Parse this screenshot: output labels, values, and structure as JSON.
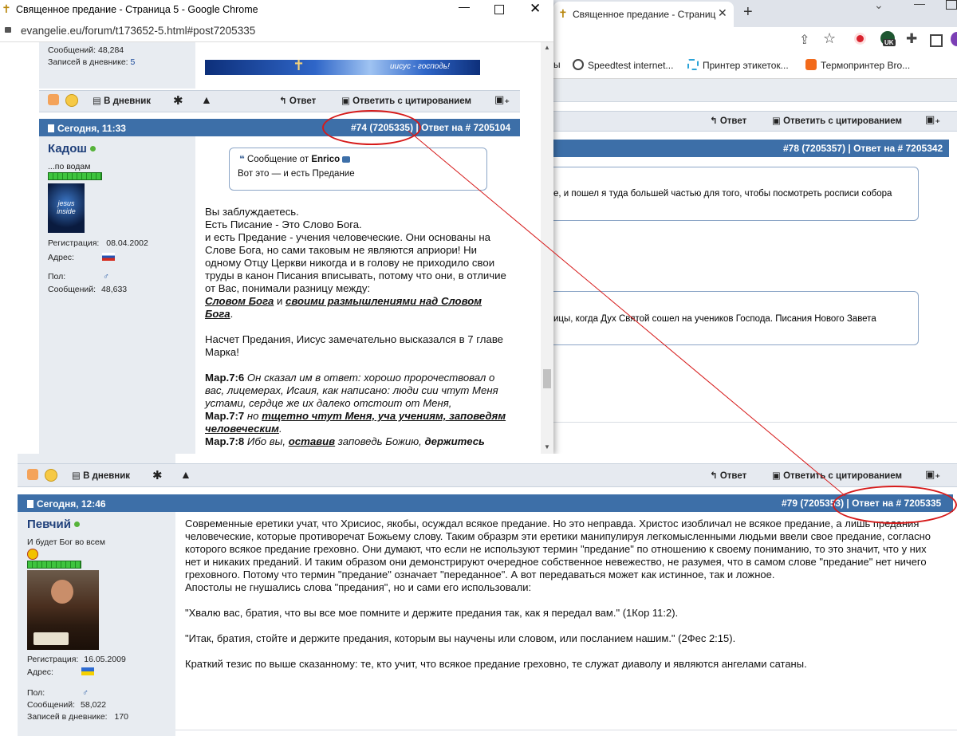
{
  "background_window": {
    "tab_title": "Священное предание - Страниц",
    "new_tab": "+",
    "bookmarks": [
      {
        "label": "ы",
        "color": ""
      },
      {
        "label": "Speedtest internet...",
        "color": "#444444"
      },
      {
        "label": "Принтер этикеток...",
        "color": "#2aa3d8"
      },
      {
        "label": "Термопринтер Bro...",
        "color": "#f26a1b"
      }
    ],
    "buttons": {
      "reply": "Ответ",
      "reply_quote": "Ответить с цитированием"
    },
    "post78_header": "#78 (7205357) | Ответ на # 7205342",
    "quote1_text": "е, и пошел я туда большей частью для того, чтобы посмотреть росписи собора",
    "quote2_text": "ицы, когда Дух Святой сошел на учеников Господа. Писания Нового Завета",
    "uk_badge": "UK"
  },
  "foreground_window": {
    "title": "Священное предание - Страница 5 - Google Chrome",
    "url": "evangelie.eu/forum/t173652-5.html#post7205335",
    "prev_user": {
      "messages_label": "Сообщений:",
      "messages": "48,284",
      "diary_label": "Записей в дневнике:",
      "diary": "5"
    },
    "banner_text": "иисус - господь!",
    "toolbar": {
      "diary": "В дневник",
      "reply": "Ответ",
      "reply_quote": "Ответить с цитированием"
    },
    "post_header": {
      "date": "Сегодня, 11:33",
      "ref": "#74 (7205335) | Ответ на # 7205104"
    },
    "user": {
      "name": "Кадош",
      "status": "...по водам",
      "avatar_text": "jesus inside",
      "reg_label": "Регистрация:",
      "reg": "08.04.2002",
      "addr_label": "Адрес:",
      "sex_label": "Пол:",
      "sex": "♂",
      "msgs_label": "Сообщений:",
      "msgs": "48,633"
    },
    "quote": {
      "prefix": "Сообщение от",
      "author": "Enrico",
      "text": "Вот это — и есть Предание"
    },
    "body": {
      "p1": "Вы заблуждаетесь.",
      "p2": "Есть Писание - Это Слово Бога.",
      "p3": "и есть Предание - учения человеческие. Они основаны на Слове Бога, но сами таковым не являются априори! Ни одному Отцу Церкви никогда и в голову не приходило свои труды в канон Писания вписывать, потому что они, в отличие от Вас, понимали разницу между:",
      "em1": "Словом Бога",
      "and": " и ",
      "em2": "своими размышлениями над Словом Бога",
      "dot": ".",
      "p4": "Насчет Предания, Иисус замечательно высказался в 7 главе Марка!",
      "v6_ref": "Мар.7:6",
      "v6_text": " Он сказал им в ответ: хорошо пророчествовал о вас, лицемерах, Исаия, как написано: люди сии чтут Меня устами, сердце же их далеко отстоит от Меня,",
      "v7_ref": "Мар.7:7",
      "v7_a": " но ",
      "v7_b": "тщетно чтут Меня, уча учениям, заповедям человеческим",
      "v7_c": ".",
      "v8_ref": "Мар.7:8",
      "v8_a": " Ибо вы, ",
      "v8_b": "оставив",
      "v8_c": " заповедь Божию, ",
      "v8_d": "держитесь"
    }
  },
  "bottom_post": {
    "toolbar": {
      "diary": "В дневник",
      "reply": "Ответ",
      "reply_quote": "Ответить с цитированием"
    },
    "header": {
      "date": "Сегодня, 12:46",
      "ref": "#79 (7205353) | Ответ на # 7205335"
    },
    "user": {
      "name": "Певчий",
      "status": "И будет Бог во всем",
      "reg_label": "Регистрация:",
      "reg": "16.05.2009",
      "addr_label": "Адрес:",
      "sex_label": "Пол:",
      "sex": "♂",
      "msgs_label": "Сообщений:",
      "msgs": "58,022",
      "diary_label": "Записей в дневнике:",
      "diary": "170"
    },
    "body": {
      "p1": "Современные еретики учат, что Хрисиос, якобы, осуждал всякое предание. Но это неправда. Христос изобличал не всякое предание, а лишь предания человеческие, которые противоречат Божьему слову. Таким образрм эти еретики манипулируя легкомысленными людьми ввели свое предание, согласно которого всякое предание греховно. Они думают, что если не используют термин \"предание\" по отношению к своему пониманию, то это значит, что у них нет и никаких преданий. И таким образом они демонстрируют очередное собственное невежество, не разумея, что в самом слове \"предание\" нет ничего греховного. Потому что термин \"предание\" означает \"переданное\". А вот передаваться может как истинное, так и ложное.",
      "p2": "Апостолы не гнушались слова \"предания\", но и сами его использовали:",
      "p3": "\"Хвалю вас, братия, что вы все мое помните и держите предания так, как я передал вам.\" (1Кор 11:2).",
      "p4": "\"Итак, братия, стойте и держите предания, которым вы научены или словом, или посланием нашим.\" (2Фес 2:15).",
      "p5": "Краткий тезис по выше сказанному: те, кто учит, что всякое предание греховно, те служат диаволу и являются ангелами сатаны."
    }
  },
  "colors": {
    "header_blue": "#3d6fa8",
    "annotation_red": "#d61a1a",
    "online_green": "#56b33a"
  }
}
